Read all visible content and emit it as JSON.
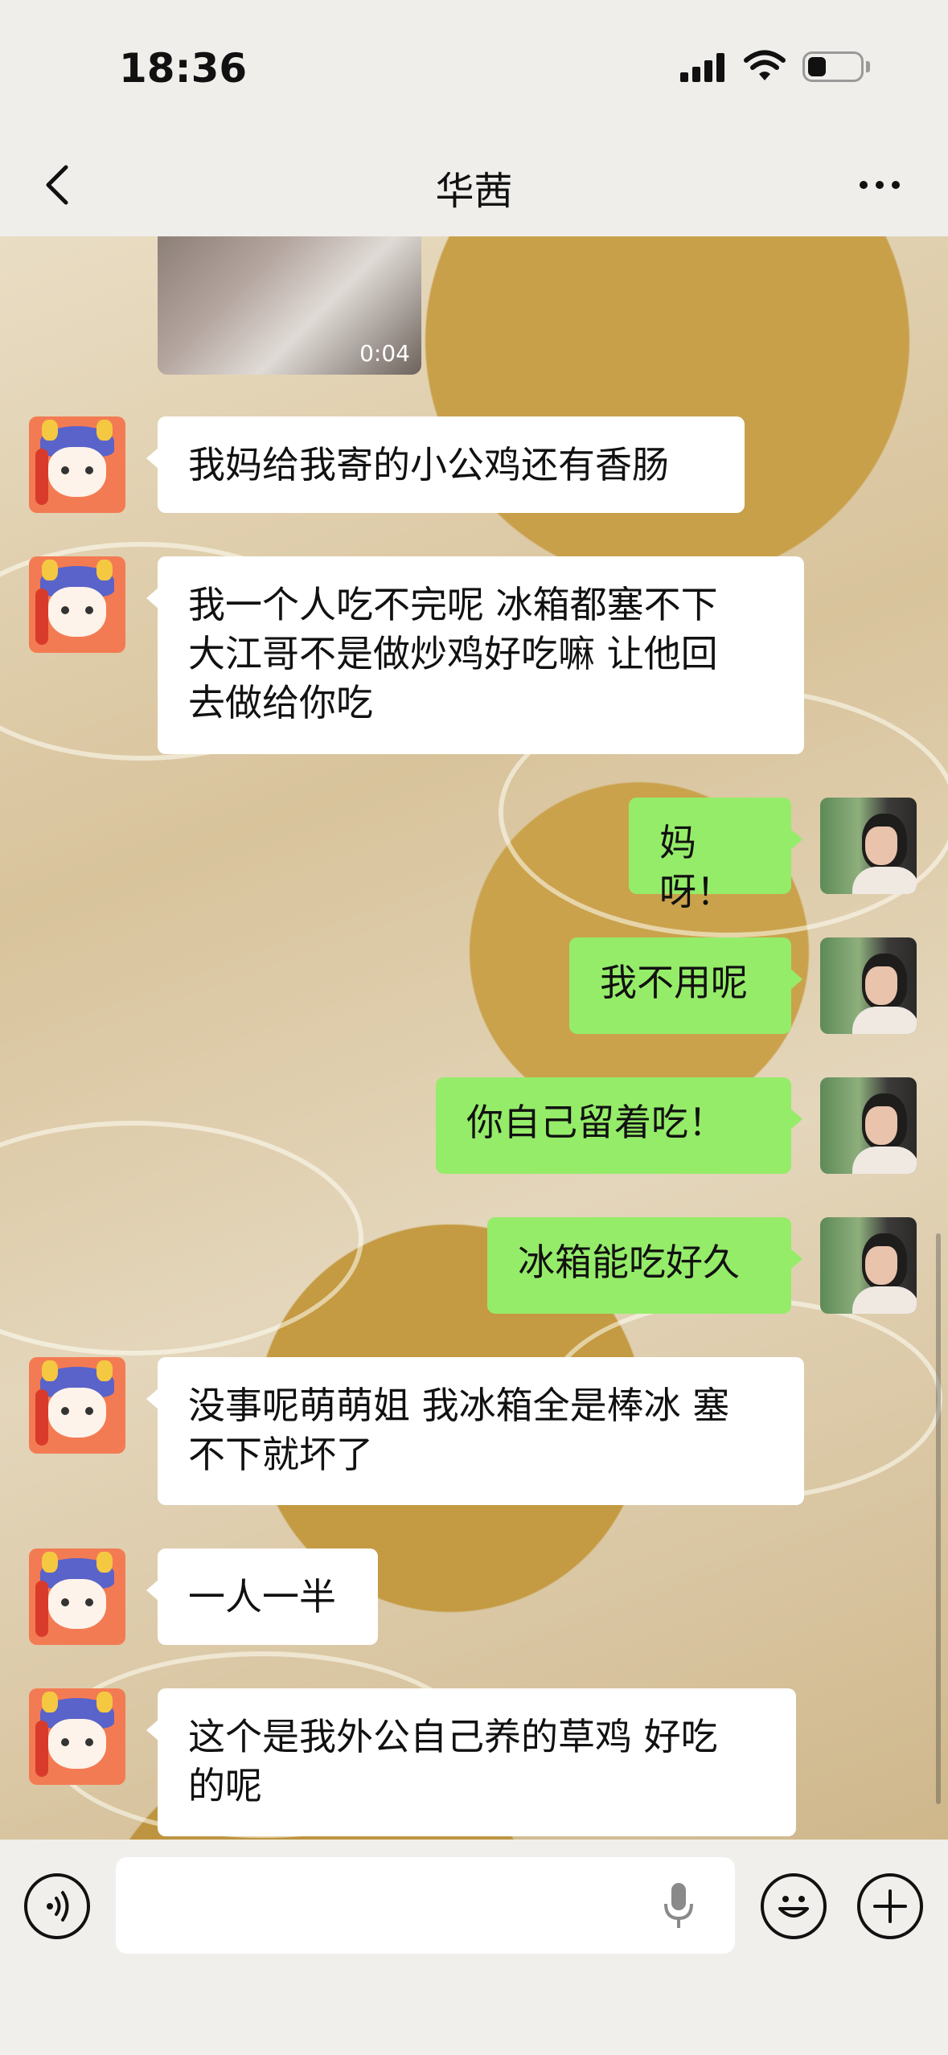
{
  "status_bar": {
    "time": "18:36"
  },
  "header": {
    "title": "华茜"
  },
  "messages": [
    {
      "from": "contact",
      "type": "video",
      "duration": "0:04"
    },
    {
      "from": "contact",
      "text": "我妈给我寄的小公鸡还有香肠"
    },
    {
      "from": "contact",
      "lines": [
        "我一个人吃不完呢 冰箱都塞不下",
        "大江哥不是做炒鸡好吃嘛 让他回",
        "去做给你吃"
      ]
    },
    {
      "from": "me",
      "text": "妈呀！"
    },
    {
      "from": "me",
      "text": "我不用呢"
    },
    {
      "from": "me",
      "text": "你自己留着吃！"
    },
    {
      "from": "me",
      "text": "冰箱能吃好久"
    },
    {
      "from": "contact",
      "lines": [
        "没事呢萌萌姐 我冰箱全是棒冰 塞",
        "不下就坏了"
      ]
    },
    {
      "from": "contact",
      "text": "一人一半"
    },
    {
      "from": "contact",
      "lines": [
        "这个是我外公自己养的草鸡 好吃",
        "的呢"
      ]
    }
  ],
  "icons": {
    "back": "chevron-left-icon",
    "more": "more-dots-icon",
    "voice": "voice-input-icon",
    "mic": "microphone-icon",
    "emoji": "emoji-icon",
    "plus": "plus-icon"
  },
  "colors": {
    "outgoing_bubble": "#95ec69",
    "incoming_bubble": "#ffffff",
    "bars_background": "#efeeeb"
  }
}
